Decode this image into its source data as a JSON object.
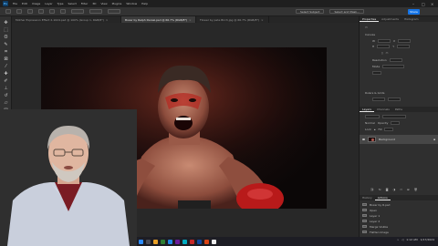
{
  "menubar": {
    "items": [
      "File",
      "Edit",
      "Image",
      "Layer",
      "Type",
      "Select",
      "Filter",
      "3D",
      "View",
      "Plugins",
      "Window",
      "Help"
    ]
  },
  "optionsbar": {
    "select_subject_label": "Select Subject",
    "select_and_mask_label": "Select and Mask...",
    "share_label": "Share"
  },
  "tabs": [
    {
      "label": "Mother Expression Effect 2-1024.psd @ 100% (Group 1, RGB/8*)",
      "active": false
    },
    {
      "label": "Boxer by Ralph Daniel.psd @ 66.7% (RGB/8*)",
      "active": true
    },
    {
      "label": "Flower by pete Birch.jpg @ 66.7% (RGB/8*)",
      "active": false
    }
  ],
  "panels": {
    "properties_tabs": [
      "Properties",
      "Adjustments",
      "Histogram"
    ],
    "layers_tabs": [
      "Layers",
      "Channels",
      "Paths"
    ],
    "history_tabs": [
      "History",
      "Actions"
    ],
    "brush_tabs": [
      "Brushes",
      "Info"
    ],
    "properties": {
      "section_canvas": "Canvas",
      "w_label": "W",
      "h_label": "H",
      "x_label": "X",
      "y_label": "Y",
      "resolution_label": "Resolution",
      "mode_label": "Mode",
      "section_rulers": "Rulers & Grids"
    },
    "layers": {
      "blend_mode": "Normal",
      "opacity_label": "Opacity",
      "lock_label": "Lock",
      "fill_label": "Fill",
      "layer_name": "Background"
    },
    "history": {
      "items": [
        "Boxer by R.psd",
        "Open",
        "Layer 1",
        "Layer 2",
        "Merge Visible",
        "Flatten Image"
      ]
    }
  },
  "taskbar": {
    "time": "1:12 AM",
    "date": "1/17/2024"
  }
}
